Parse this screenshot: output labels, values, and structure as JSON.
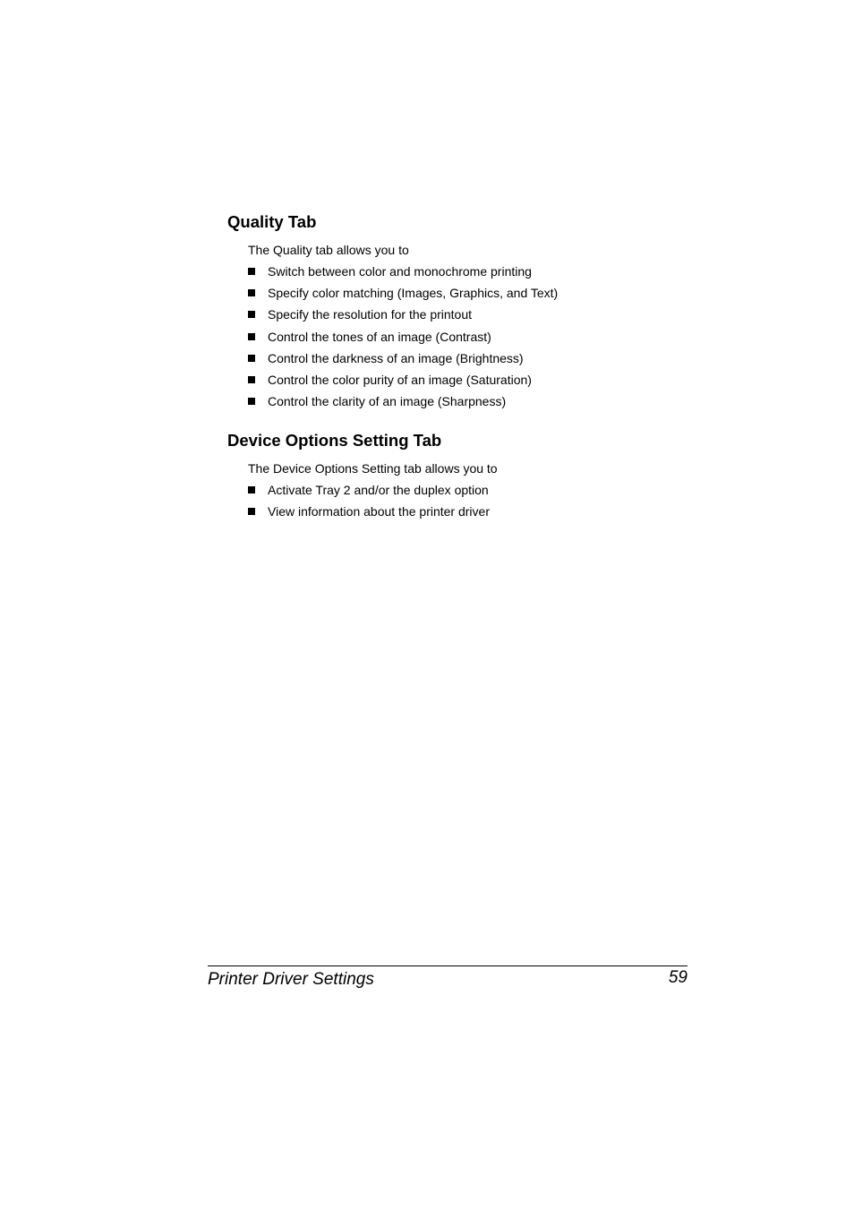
{
  "quality_section": {
    "heading": "Quality Tab",
    "intro": "The Quality tab allows you to",
    "items": [
      "Switch between color and monochrome printing",
      "Specify color matching (Images, Graphics, and Text)",
      "Specify the resolution for the printout",
      "Control the tones of an image (Contrast)",
      "Control the darkness of an image (Brightness)",
      "Control the color purity of an image (Saturation)",
      "Control the clarity of an image (Sharpness)"
    ]
  },
  "device_section": {
    "heading": "Device Options Setting Tab",
    "intro": "The Device Options Setting tab allows you to",
    "items": [
      "Activate Tray 2 and/or the duplex option",
      "View information about the printer driver"
    ]
  },
  "footer": {
    "title": "Printer Driver Settings",
    "page_number": "59"
  }
}
